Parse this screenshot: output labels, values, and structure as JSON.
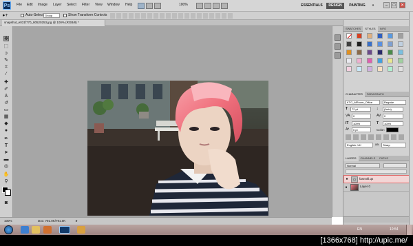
{
  "app": {
    "logo": "Ps",
    "menu": [
      "File",
      "Edit",
      "Image",
      "Layer",
      "Select",
      "Filter",
      "View",
      "Window",
      "Help"
    ],
    "zoom": "100%",
    "workspaces": [
      "ESSENTIALS",
      "DESIGN",
      "PAINTING"
    ],
    "active_workspace": "DESIGN",
    "window_buttons": [
      "–",
      "□",
      "✕"
    ]
  },
  "options_bar": {
    "auto_select_label": "Auto-Select:",
    "auto_select_value": "Group",
    "show_transform_label": "Show Transform Controls"
  },
  "document": {
    "tab_title": "snapshot_e031f770_80520253.jpg @ 100% (RGB/8) *",
    "status_zoom": "100%",
    "status_doc": "Doc: 791.0K/791.0K"
  },
  "panels": {
    "swatches_tabs": [
      "SWATCHES",
      "STYLES",
      "INFO"
    ],
    "swatches_active": "STYLES",
    "character_tabs": [
      "CHARACTER",
      "PARAGRAPH"
    ],
    "font_family": "KTG_MRoom_Office",
    "font_style": "Regular",
    "font_size": "72 pt",
    "leading": "(Auto)",
    "kerning": "0",
    "tracking": "0",
    "vertical_scale": "100%",
    "horizontal_scale": "100%",
    "baseline_shift": "0 pt",
    "color_label": "Color:",
    "language": "English: UK",
    "antialias": "Sharp",
    "layers_tabs": [
      "LAYERS",
      "CHANNELS",
      "PATHS"
    ],
    "blend_mode": "Normal",
    "layers": [
      {
        "name": "fasnnkl.qs",
        "selected": true
      },
      {
        "name": "Layer 0",
        "selected": false
      }
    ]
  },
  "taskbar": {
    "language": "EN",
    "clock": "10:54"
  },
  "caption": "[1366x768] http://upic.me/"
}
